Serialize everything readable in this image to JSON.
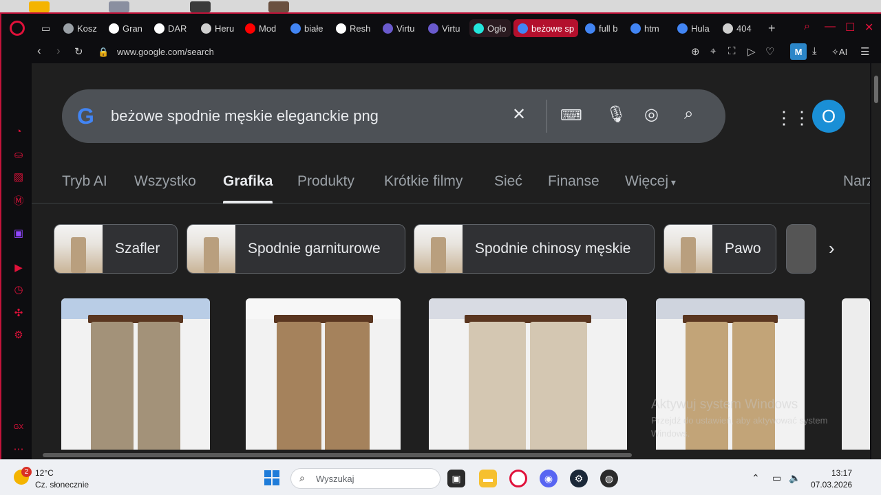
{
  "browser": {
    "tabs": [
      {
        "label": "Kosz",
        "icon": "cart-icon",
        "color": "#9aa0a6"
      },
      {
        "label": "Gran",
        "icon": "v-logo-icon",
        "color": "#ffffff"
      },
      {
        "label": "DAR",
        "icon": "ff-logo-icon",
        "color": "#ffffff"
      },
      {
        "label": "Heru",
        "icon": "openai-icon",
        "color": "#cfcfcf"
      },
      {
        "label": "Mod",
        "icon": "youtube-icon",
        "color": "#ff0000"
      },
      {
        "label": "białe",
        "icon": "google-icon",
        "color": "#4285f4"
      },
      {
        "label": "Resh",
        "icon": "resh-icon",
        "color": "#ffffff"
      },
      {
        "label": "Virtu",
        "icon": "virtu-icon",
        "color": "#6a5acd"
      },
      {
        "label": "Virtu",
        "icon": "virtu-icon",
        "color": "#6a5acd"
      },
      {
        "label": "Ogło",
        "icon": "olx-icon",
        "color": "#23e5db"
      },
      {
        "label": "beżowe sp",
        "icon": "google-icon",
        "color": "#4285f4"
      },
      {
        "label": "full b",
        "icon": "google-icon",
        "color": "#4285f4"
      },
      {
        "label": "htm",
        "icon": "google-icon",
        "color": "#4285f4"
      },
      {
        "label": "Hula",
        "icon": "google-icon",
        "color": "#4285f4"
      },
      {
        "label": "404",
        "icon": "page-icon",
        "color": "#cfcfcf"
      }
    ],
    "url": "www.google.com/search",
    "m_badge": "M",
    "ai_label": "AI"
  },
  "search": {
    "query": "beżowe spodnie męskie eleganckie png",
    "avatar_letter": "O"
  },
  "filters": [
    "Tryb AI",
    "Wszystko",
    "Grafika",
    "Produkty",
    "Krótkie filmy",
    "Sieć",
    "Finanse",
    "Więcej",
    "Narz"
  ],
  "active_filter": "Grafika",
  "chips": [
    "Szafler",
    "Spodnie garniturowe",
    "Spodnie chinosy męskie",
    "Pawo"
  ],
  "results": [
    {
      "shirt": "#b9cde6",
      "pants": "#a39279"
    },
    {
      "shirt": "#f7f7f7",
      "pants": "#a5825c"
    },
    {
      "shirt": "#d8dbe3",
      "pants": "#d4c7b2"
    },
    {
      "shirt": "#cfd4de",
      "pants": "#c2a478"
    }
  ],
  "watermark": {
    "title": "Aktywuj system Windows",
    "line1": "Przejdź do ustawień, aby aktywować system",
    "line2": "Windows."
  },
  "taskbar": {
    "weather_badge": "2",
    "temp": "12°C",
    "condition": "Cz. słonecznie",
    "search_placeholder": "Wyszukaj",
    "time": "13:17",
    "date": "07.03.2026"
  },
  "colors": {
    "accent": "#e0113a",
    "google_blue": "#4285f4",
    "avatar": "#1a8fd6"
  }
}
